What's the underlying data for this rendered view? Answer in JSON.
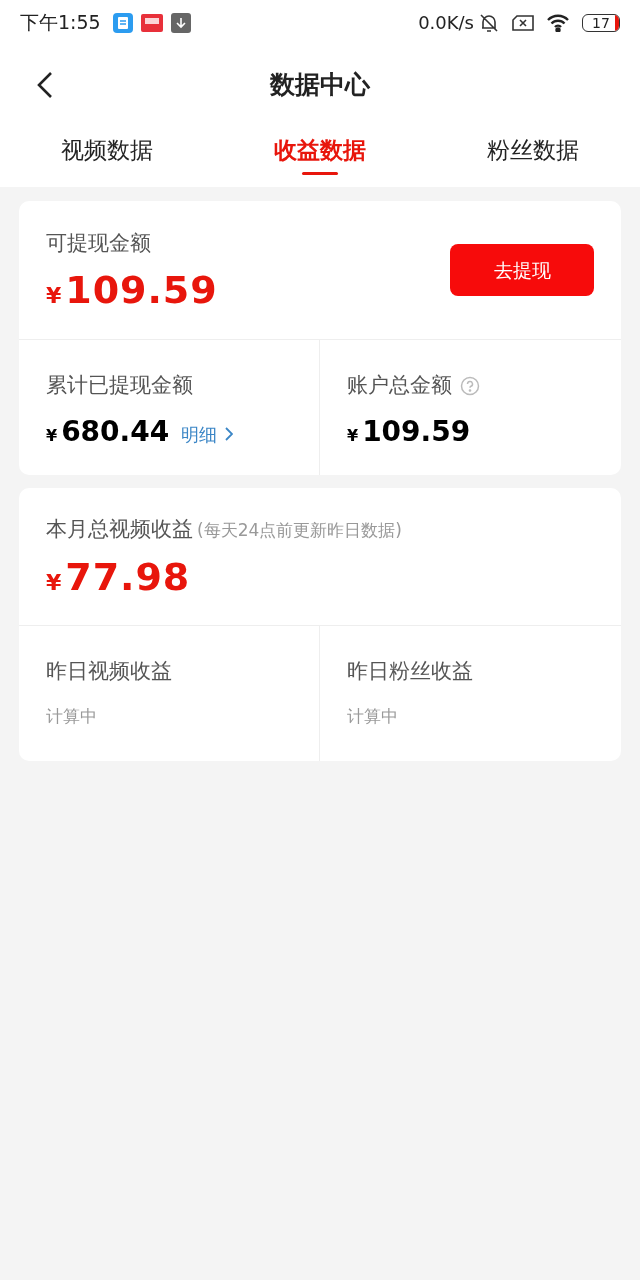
{
  "status_bar": {
    "time": "下午1:55",
    "speed": "0.0K/s",
    "battery": "17"
  },
  "header": {
    "title": "数据中心"
  },
  "tabs": [
    {
      "label": "视频数据",
      "selected": false
    },
    {
      "label": "收益数据",
      "selected": true
    },
    {
      "label": "粉丝数据",
      "selected": false
    }
  ],
  "balance_card": {
    "label": "可提现金额",
    "currency": "¥",
    "amount": "109.59",
    "button": "去提现",
    "stats": [
      {
        "label": "累计已提现金额",
        "currency": "¥",
        "amount": "680.44",
        "link": "明细",
        "help": false
      },
      {
        "label": "账户总金额",
        "currency": "¥",
        "amount": "109.59",
        "help": true
      }
    ]
  },
  "monthly_card": {
    "label": "本月总视频收益",
    "note": "(每天24点前更新昨日数据)",
    "currency": "¥",
    "amount": "77.98",
    "stats": [
      {
        "label": "昨日视频收益",
        "value": "计算中"
      },
      {
        "label": "昨日粉丝收益",
        "value": "计算中"
      }
    ]
  }
}
